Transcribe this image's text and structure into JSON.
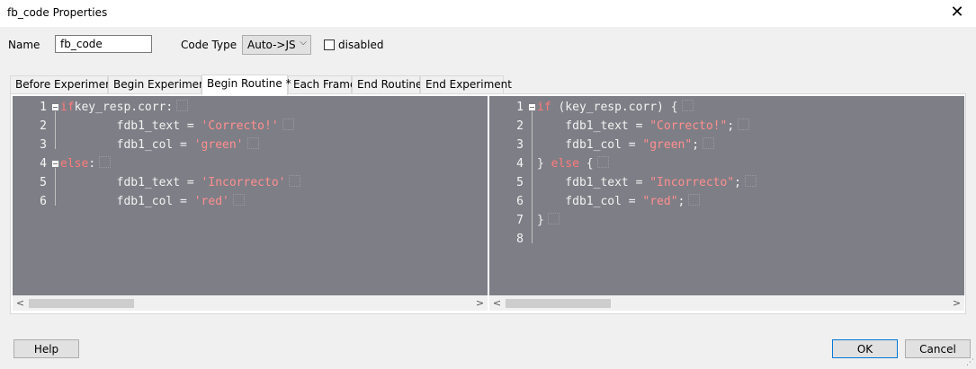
{
  "window": {
    "title": "fb_code Properties"
  },
  "form": {
    "name_label": "Name",
    "name_value": "fb_code",
    "codetype_label": "Code Type",
    "codetype_value": "Auto->JS",
    "disabled_label": "disabled",
    "disabled_checked": false
  },
  "tabs": [
    {
      "label": "Before Experiment"
    },
    {
      "label": "Begin Experiment"
    },
    {
      "label": "Begin Routine *",
      "active": true
    },
    {
      "label": "Each Frame"
    },
    {
      "label": "End Routine"
    },
    {
      "label": "End Experiment"
    }
  ],
  "editors": {
    "python": {
      "lines": [
        {
          "n": "1",
          "tokens": [
            [
              "kw",
              "if"
            ],
            [
              "",
              "key_resp.corr:"
            ]
          ]
        },
        {
          "n": "2",
          "tokens": [
            [
              "",
              "        fdb1_text = "
            ],
            [
              "str",
              "'Correcto!'"
            ]
          ]
        },
        {
          "n": "3",
          "tokens": [
            [
              "",
              "        fdb1_col = "
            ],
            [
              "str",
              "'green'"
            ]
          ]
        },
        {
          "n": "4",
          "tokens": [
            [
              "kw",
              "else"
            ],
            [
              "",
              ":"
            ]
          ]
        },
        {
          "n": "5",
          "tokens": [
            [
              "",
              "        fdb1_text = "
            ],
            [
              "str",
              "'Incorrecto'"
            ]
          ]
        },
        {
          "n": "6",
          "tokens": [
            [
              "",
              "        fdb1_col = "
            ],
            [
              "str",
              "'red'"
            ]
          ]
        }
      ]
    },
    "javascript": {
      "lines": [
        {
          "n": "1",
          "tokens": [
            [
              "kw",
              "if"
            ],
            [
              "",
              " (key_resp.corr) {"
            ]
          ]
        },
        {
          "n": "2",
          "tokens": [
            [
              "",
              "    fdb1_text = "
            ],
            [
              "str",
              "\"Correcto!\""
            ],
            [
              "",
              ";"
            ]
          ]
        },
        {
          "n": "3",
          "tokens": [
            [
              "",
              "    fdb1_col = "
            ],
            [
              "str",
              "\"green\""
            ],
            [
              "",
              ";"
            ]
          ]
        },
        {
          "n": "4",
          "tokens": [
            [
              "",
              "} "
            ],
            [
              "kw",
              "else"
            ],
            [
              "",
              " {"
            ]
          ]
        },
        {
          "n": "5",
          "tokens": [
            [
              "",
              "    fdb1_text = "
            ],
            [
              "str",
              "\"Incorrecto\""
            ],
            [
              "",
              ";"
            ]
          ]
        },
        {
          "n": "6",
          "tokens": [
            [
              "",
              "    fdb1_col = "
            ],
            [
              "str",
              "\"red\""
            ],
            [
              "",
              ";"
            ]
          ]
        },
        {
          "n": "7",
          "tokens": [
            [
              "",
              "}"
            ]
          ]
        },
        {
          "n": "8",
          "tokens": []
        }
      ]
    }
  },
  "buttons": {
    "help": "Help",
    "ok": "OK",
    "cancel": "Cancel"
  },
  "colors": {
    "editor_bg": "#7e7e86",
    "keyword": "#ff7a7a",
    "string": "#ff8f8f",
    "default_button_border": "#0078d7"
  }
}
